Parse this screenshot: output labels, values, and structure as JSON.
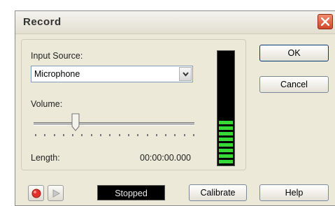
{
  "window": {
    "title": "Record"
  },
  "input_source": {
    "label": "Input Source:",
    "value": "Microphone"
  },
  "volume": {
    "label": "Volume:",
    "level_percent": 26
  },
  "length": {
    "label": "Length:",
    "value": "00:00:00.000"
  },
  "level_meter": {
    "lit_fraction": 0.38
  },
  "buttons": {
    "ok": "OK",
    "cancel": "Cancel",
    "calibrate": "Calibrate",
    "help": "Help"
  },
  "status": {
    "text": "Stopped"
  },
  "icons": {
    "record": "record-icon",
    "play": "play-icon",
    "close": "close-icon",
    "dropdown": "chevron-down-icon"
  },
  "colors": {
    "record_red": "#e0322b",
    "meter_green": "#38d838",
    "status_bg": "#000000"
  }
}
